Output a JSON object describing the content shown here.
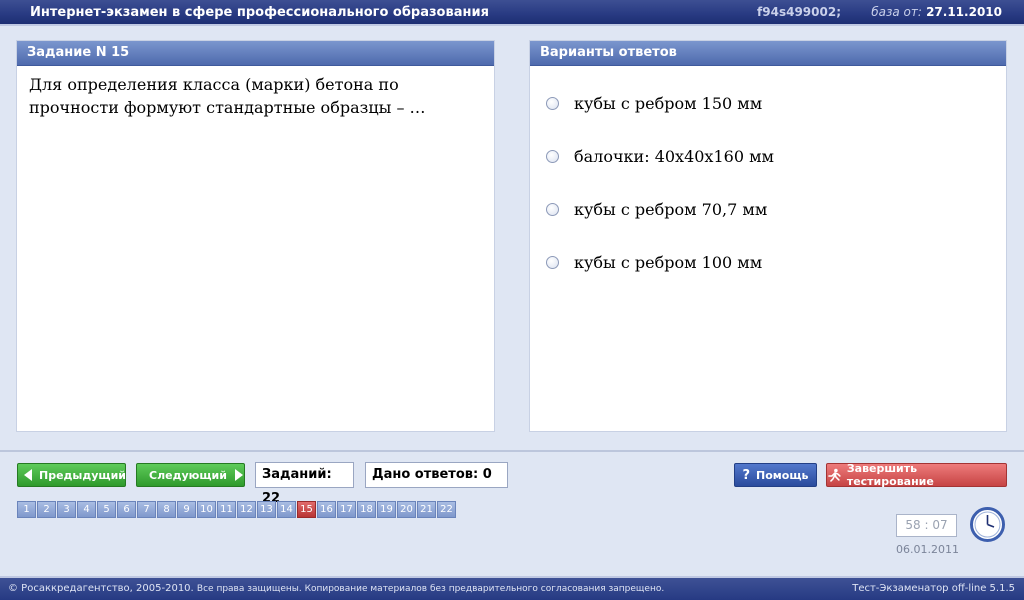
{
  "header": {
    "title": "Интернет-экзамен в сфере профессионального образования",
    "id": "f94s499002;",
    "base_label": "база от:",
    "base_date": "27.11.2010"
  },
  "task": {
    "title": "Задание N 15",
    "text": "Для определения класса (марки) бетона по прочности формуют стандартные образцы – …"
  },
  "answers": {
    "title": "Варианты ответов",
    "options": [
      "кубы с ребром 150 мм",
      "балочки: 40x40x160 мм",
      "кубы с ребром 70,7 мм",
      "кубы с ребром 100 мм"
    ]
  },
  "nav": {
    "prev_label": "Предыдущий",
    "next_label": "Следующий",
    "tasks_count": "Заданий: 22",
    "answers_given": "Дано ответов: 0",
    "help_label": "Помощь",
    "finish_label": "Завершить тестирование"
  },
  "pages": [
    "1",
    "2",
    "3",
    "4",
    "5",
    "6",
    "7",
    "8",
    "9",
    "10",
    "11",
    "12",
    "13",
    "14",
    "15",
    "16",
    "17",
    "18",
    "19",
    "20",
    "21",
    "22"
  ],
  "current_page": "15",
  "timer": {
    "value": "58 : 07",
    "date": "06.01.2011"
  },
  "footer": {
    "copyright": "© Росаккредагентство, 2005-2010.",
    "notice": "Все права защищены. Копирование материалов без предварительного согласования запрещено.",
    "version": "Тест-Экзаменатор off-line 5.1.5"
  },
  "colors": {
    "header_bg": "#283a82",
    "panel_header": "#5e7abb",
    "active_page": "#c94040",
    "green_button": "#3aa836",
    "red_button": "#d35252",
    "blue_button": "#3457ab"
  }
}
